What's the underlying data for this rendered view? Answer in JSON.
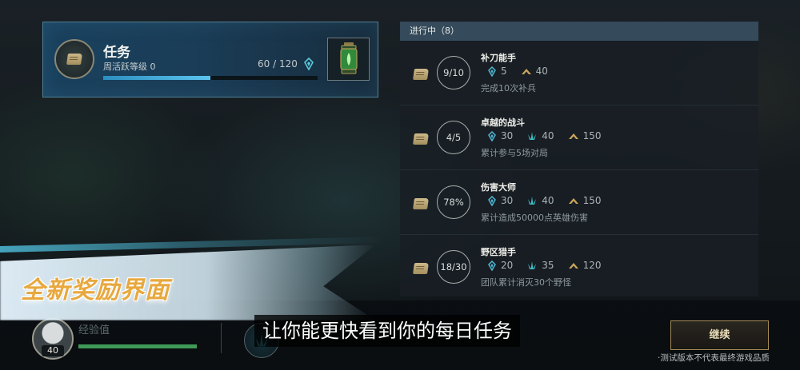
{
  "quest_card": {
    "title": "任务",
    "subtitle": "周活跃等级 0",
    "progress_text": "60 / 120",
    "progress_fraction": 0.5
  },
  "list": {
    "header": "进行中（8）",
    "items": [
      {
        "progress": "9/10",
        "title": "补刀能手",
        "rewards": [
          {
            "icon": "blue-essence-icon",
            "value": "5"
          },
          {
            "icon": "gold-chevron-icon",
            "value": "40"
          }
        ],
        "desc": "完成10次补兵"
      },
      {
        "progress": "4/5",
        "title": "卓越的战斗",
        "rewards": [
          {
            "icon": "blue-essence-icon",
            "value": "30"
          },
          {
            "icon": "crystal-shard-icon",
            "value": "40"
          },
          {
            "icon": "gold-chevron-icon",
            "value": "150"
          }
        ],
        "desc": "累计参与5场对局"
      },
      {
        "progress": "78%",
        "title": "伤害大师",
        "rewards": [
          {
            "icon": "blue-essence-icon",
            "value": "30"
          },
          {
            "icon": "crystal-shard-icon",
            "value": "40"
          },
          {
            "icon": "gold-chevron-icon",
            "value": "150"
          }
        ],
        "desc": "累计造成50000点英雄伤害"
      },
      {
        "progress": "18/30",
        "title": "野区猎手",
        "rewards": [
          {
            "icon": "blue-essence-icon",
            "value": "20"
          },
          {
            "icon": "crystal-shard-icon",
            "value": "35"
          },
          {
            "icon": "gold-chevron-icon",
            "value": "120"
          }
        ],
        "desc": "团队累计消灭30个野怪"
      }
    ]
  },
  "bottom": {
    "level": "40",
    "xp_label": "经验值",
    "xp_fraction": 1.0,
    "continue_label": "继续",
    "disclaimer": "·测试版本不代表最终游戏品质"
  },
  "overlay": {
    "promo": "全新奖励界面",
    "subtitle": "让你能更快看到你的每日任务"
  },
  "colors": {
    "accent_blue": "#5cc4ee",
    "gold": "#c9a45a",
    "xp_green": "#3f9a57"
  }
}
